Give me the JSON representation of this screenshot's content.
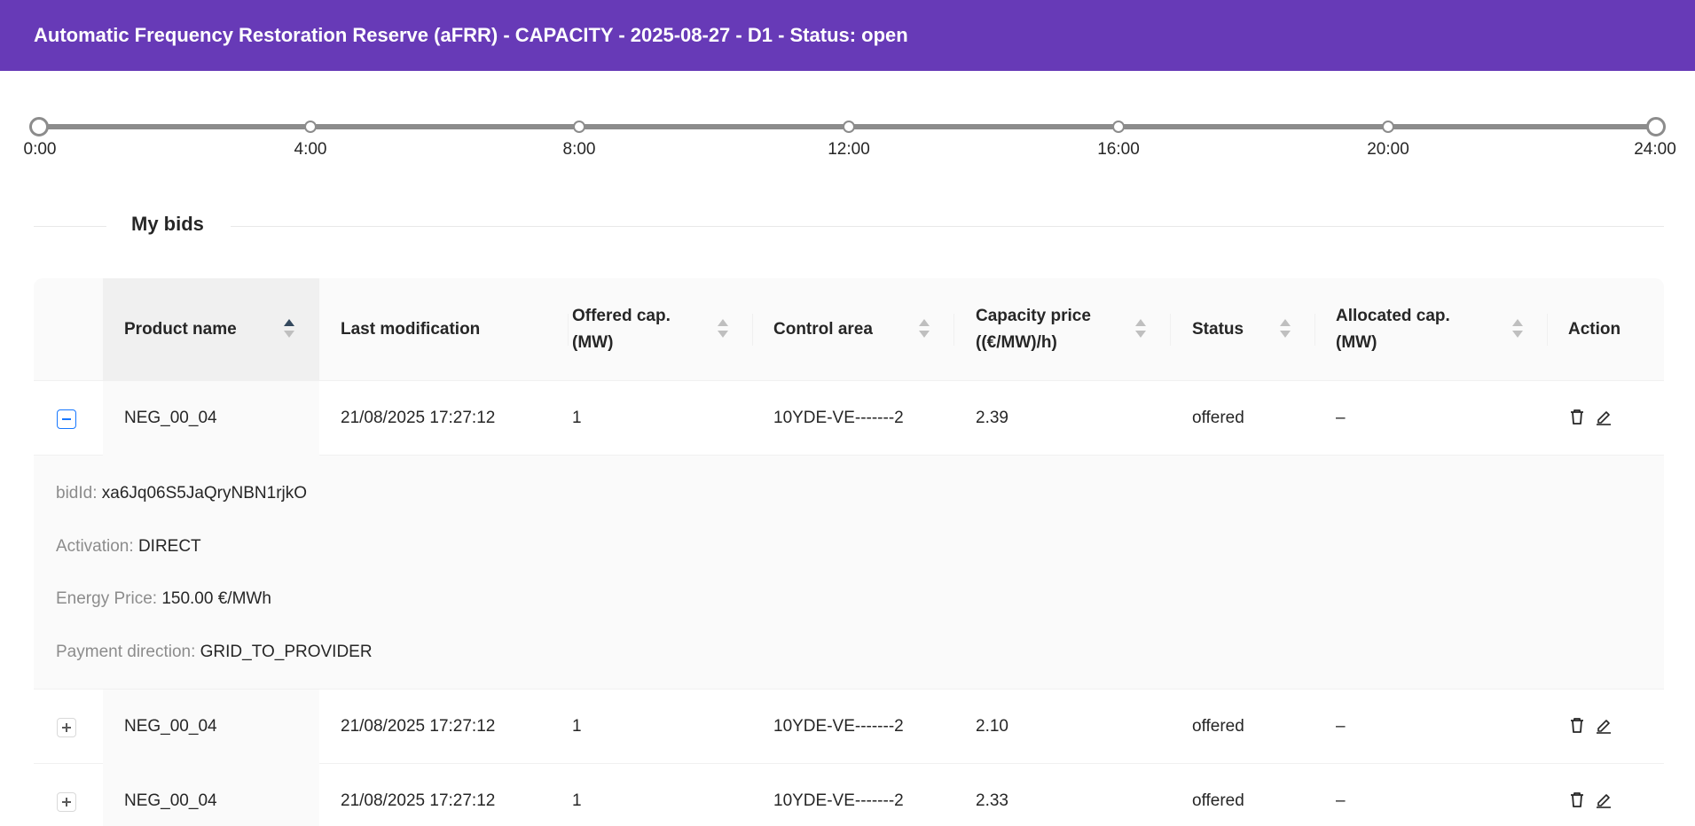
{
  "header": {
    "title": "Automatic Frequency Restoration Reserve (aFRR) - CAPACITY - 2025-08-27 - D1 - Status: open",
    "bg_color": "#673ab7"
  },
  "timeline": {
    "labels": [
      "0:00",
      "4:00",
      "8:00",
      "12:00",
      "16:00",
      "20:00",
      "24:00"
    ]
  },
  "section": {
    "title": "My bids"
  },
  "table": {
    "columns": {
      "product_name": "Product name",
      "last_modification": "Last modification",
      "offered_cap": "Offered cap. (MW)",
      "control_area": "Control area",
      "capacity_price": "Capacity price ((€/MW)/h)",
      "status": "Status",
      "allocated_cap": "Allocated cap. (MW)",
      "action": "Action"
    },
    "rows": [
      {
        "product_name": "NEG_00_04",
        "last_modification": "21/08/2025 17:27:12",
        "offered_cap": "1",
        "control_area": "10YDE-VE-------2",
        "capacity_price": "2.39",
        "status": "offered",
        "allocated_cap": "–",
        "expanded": true,
        "details": {
          "bid_id_label": "bidId:",
          "bid_id": "xa6Jq06S5JaQryNBN1rjkO",
          "activation_label": "Activation:",
          "activation": "DIRECT",
          "energy_price_label": "Energy Price:",
          "energy_price": "150.00 €/MWh",
          "payment_direction_label": "Payment direction:",
          "payment_direction": "GRID_TO_PROVIDER"
        }
      },
      {
        "product_name": "NEG_00_04",
        "last_modification": "21/08/2025 17:27:12",
        "offered_cap": "1",
        "control_area": "10YDE-VE-------2",
        "capacity_price": "2.10",
        "status": "offered",
        "allocated_cap": "–",
        "expanded": false
      },
      {
        "product_name": "NEG_00_04",
        "last_modification": "21/08/2025 17:27:12",
        "offered_cap": "1",
        "control_area": "10YDE-VE-------2",
        "capacity_price": "2.33",
        "status": "offered",
        "allocated_cap": "–",
        "expanded": false
      }
    ]
  }
}
